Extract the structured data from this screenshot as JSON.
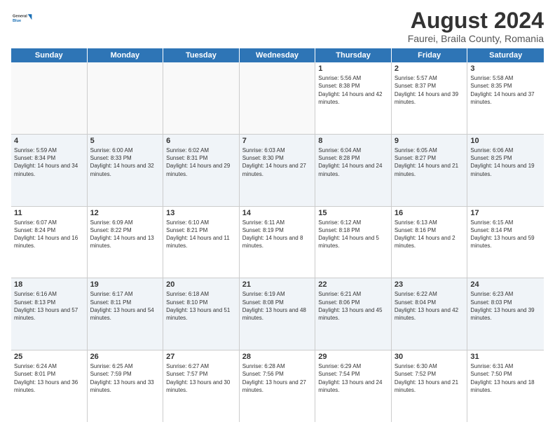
{
  "logo": {
    "general": "General",
    "blue": "Blue"
  },
  "title": "August 2024",
  "subtitle": "Faurei, Braila County, Romania",
  "days": [
    "Sunday",
    "Monday",
    "Tuesday",
    "Wednesday",
    "Thursday",
    "Friday",
    "Saturday"
  ],
  "weeks": [
    [
      {
        "day": "",
        "text": ""
      },
      {
        "day": "",
        "text": ""
      },
      {
        "day": "",
        "text": ""
      },
      {
        "day": "",
        "text": ""
      },
      {
        "day": "1",
        "text": "Sunrise: 5:56 AM\nSunset: 8:38 PM\nDaylight: 14 hours and 42 minutes."
      },
      {
        "day": "2",
        "text": "Sunrise: 5:57 AM\nSunset: 8:37 PM\nDaylight: 14 hours and 39 minutes."
      },
      {
        "day": "3",
        "text": "Sunrise: 5:58 AM\nSunset: 8:35 PM\nDaylight: 14 hours and 37 minutes."
      }
    ],
    [
      {
        "day": "4",
        "text": "Sunrise: 5:59 AM\nSunset: 8:34 PM\nDaylight: 14 hours and 34 minutes."
      },
      {
        "day": "5",
        "text": "Sunrise: 6:00 AM\nSunset: 8:33 PM\nDaylight: 14 hours and 32 minutes."
      },
      {
        "day": "6",
        "text": "Sunrise: 6:02 AM\nSunset: 8:31 PM\nDaylight: 14 hours and 29 minutes."
      },
      {
        "day": "7",
        "text": "Sunrise: 6:03 AM\nSunset: 8:30 PM\nDaylight: 14 hours and 27 minutes."
      },
      {
        "day": "8",
        "text": "Sunrise: 6:04 AM\nSunset: 8:28 PM\nDaylight: 14 hours and 24 minutes."
      },
      {
        "day": "9",
        "text": "Sunrise: 6:05 AM\nSunset: 8:27 PM\nDaylight: 14 hours and 21 minutes."
      },
      {
        "day": "10",
        "text": "Sunrise: 6:06 AM\nSunset: 8:25 PM\nDaylight: 14 hours and 19 minutes."
      }
    ],
    [
      {
        "day": "11",
        "text": "Sunrise: 6:07 AM\nSunset: 8:24 PM\nDaylight: 14 hours and 16 minutes."
      },
      {
        "day": "12",
        "text": "Sunrise: 6:09 AM\nSunset: 8:22 PM\nDaylight: 14 hours and 13 minutes."
      },
      {
        "day": "13",
        "text": "Sunrise: 6:10 AM\nSunset: 8:21 PM\nDaylight: 14 hours and 11 minutes."
      },
      {
        "day": "14",
        "text": "Sunrise: 6:11 AM\nSunset: 8:19 PM\nDaylight: 14 hours and 8 minutes."
      },
      {
        "day": "15",
        "text": "Sunrise: 6:12 AM\nSunset: 8:18 PM\nDaylight: 14 hours and 5 minutes."
      },
      {
        "day": "16",
        "text": "Sunrise: 6:13 AM\nSunset: 8:16 PM\nDaylight: 14 hours and 2 minutes."
      },
      {
        "day": "17",
        "text": "Sunrise: 6:15 AM\nSunset: 8:14 PM\nDaylight: 13 hours and 59 minutes."
      }
    ],
    [
      {
        "day": "18",
        "text": "Sunrise: 6:16 AM\nSunset: 8:13 PM\nDaylight: 13 hours and 57 minutes."
      },
      {
        "day": "19",
        "text": "Sunrise: 6:17 AM\nSunset: 8:11 PM\nDaylight: 13 hours and 54 minutes."
      },
      {
        "day": "20",
        "text": "Sunrise: 6:18 AM\nSunset: 8:10 PM\nDaylight: 13 hours and 51 minutes."
      },
      {
        "day": "21",
        "text": "Sunrise: 6:19 AM\nSunset: 8:08 PM\nDaylight: 13 hours and 48 minutes."
      },
      {
        "day": "22",
        "text": "Sunrise: 6:21 AM\nSunset: 8:06 PM\nDaylight: 13 hours and 45 minutes."
      },
      {
        "day": "23",
        "text": "Sunrise: 6:22 AM\nSunset: 8:04 PM\nDaylight: 13 hours and 42 minutes."
      },
      {
        "day": "24",
        "text": "Sunrise: 6:23 AM\nSunset: 8:03 PM\nDaylight: 13 hours and 39 minutes."
      }
    ],
    [
      {
        "day": "25",
        "text": "Sunrise: 6:24 AM\nSunset: 8:01 PM\nDaylight: 13 hours and 36 minutes."
      },
      {
        "day": "26",
        "text": "Sunrise: 6:25 AM\nSunset: 7:59 PM\nDaylight: 13 hours and 33 minutes."
      },
      {
        "day": "27",
        "text": "Sunrise: 6:27 AM\nSunset: 7:57 PM\nDaylight: 13 hours and 30 minutes."
      },
      {
        "day": "28",
        "text": "Sunrise: 6:28 AM\nSunset: 7:56 PM\nDaylight: 13 hours and 27 minutes."
      },
      {
        "day": "29",
        "text": "Sunrise: 6:29 AM\nSunset: 7:54 PM\nDaylight: 13 hours and 24 minutes."
      },
      {
        "day": "30",
        "text": "Sunrise: 6:30 AM\nSunset: 7:52 PM\nDaylight: 13 hours and 21 minutes."
      },
      {
        "day": "31",
        "text": "Sunrise: 6:31 AM\nSunset: 7:50 PM\nDaylight: 13 hours and 18 minutes."
      }
    ]
  ]
}
